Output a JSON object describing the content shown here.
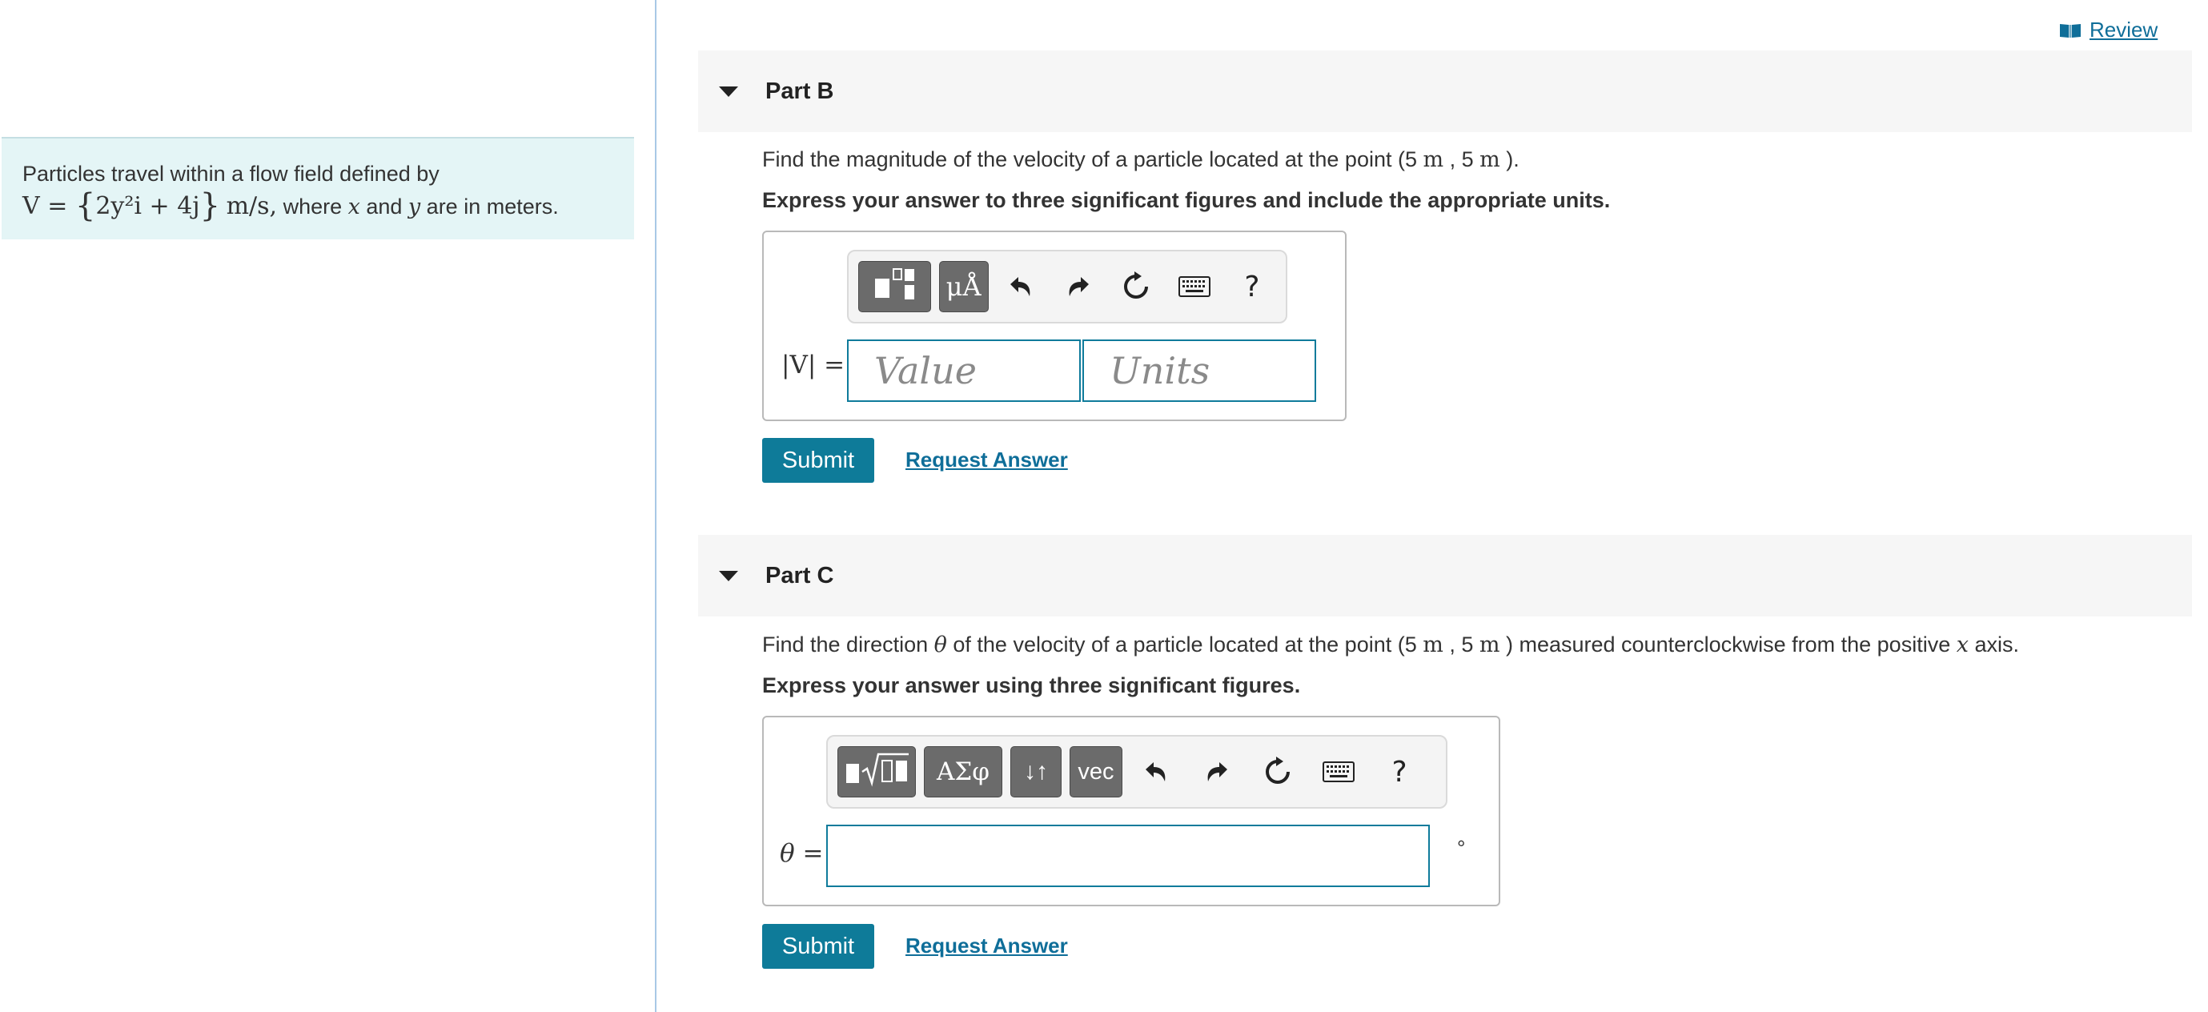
{
  "header": {
    "review_label": "Review"
  },
  "problem": {
    "line1": "Particles travel within a flow field defined by",
    "eq_lhs": "V = ",
    "eq_body": "2y²i + 4j",
    "eq_units": "m/s,",
    "tail_where": " where ",
    "var_x": "x",
    "tail_and": " and ",
    "var_y": "y",
    "tail_end": " are in meters."
  },
  "part_b": {
    "title": "Part B",
    "prompt_pre": "Find the magnitude of the velocity of a particle located at the point (5 ",
    "unit_m1": "m",
    "prompt_mid": " , 5 ",
    "unit_m2": "m",
    "prompt_post": " ).",
    "instruction": "Express your answer to three significant figures and include the appropriate units.",
    "toolbar_units_label": "μÅ",
    "toolbar_help": "?",
    "answer_label": "|V| =",
    "value_placeholder": "Value",
    "units_placeholder": "Units",
    "submit_label": "Submit",
    "request_label": "Request Answer"
  },
  "part_c": {
    "title": "Part C",
    "prompt_pre": "Find the direction ",
    "theta": "θ",
    "prompt_a": " of the velocity of a particle located at the point (5 ",
    "unit_m1": "m",
    "prompt_mid": " , 5 ",
    "unit_m2": "m",
    "prompt_b": " ) measured counterclockwise from the positive ",
    "var_x": "x",
    "prompt_end": " axis.",
    "instruction": "Express your answer using three significant figures.",
    "toolbar_greek_label": "ΑΣφ",
    "toolbar_arrows_label": "↓↑",
    "toolbar_vec_label": "vec",
    "toolbar_help": "?",
    "answer_label": "θ =",
    "answer_value": "",
    "degree_symbol": "°",
    "submit_label": "Submit",
    "request_label": "Request Answer"
  },
  "colors": {
    "accent": "#0e7b99",
    "problem_bg": "#e4f5f6",
    "divider": "#a9c8e6"
  }
}
